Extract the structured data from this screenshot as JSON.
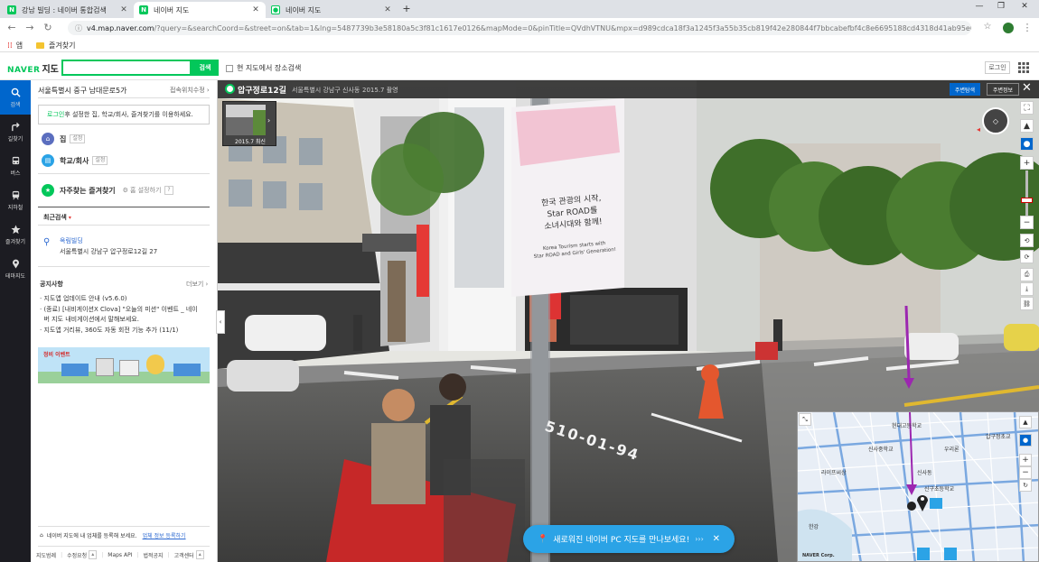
{
  "browser": {
    "tabs": [
      {
        "label": "강남 빌딩 : 네이버 통합검색",
        "favicon": "N"
      },
      {
        "label": "네이버 지도",
        "favicon": "N"
      },
      {
        "label": "네이버 지도",
        "favicon": "leaf"
      }
    ],
    "new_tab": "+",
    "url_host": "v4.map.naver.com",
    "url_path": "/?query=&searchCoord=&street=on&tab=1&lng=5487739b3e58180a5c3f81c1617e0126&mapMode=0&pinTitle=QVdhVTNU&mpx=d989cdca18f3a1245f3a55b35cb819f42e280844f7bbcabefbf4c8e6695188cd4318d41ab95e0e387a398ee5a208...",
    "bookmarks": {
      "apps": "앱",
      "favorites": "즐겨찾기"
    },
    "window_controls": [
      "—",
      "❐",
      "✕"
    ]
  },
  "header": {
    "logo_naver": "NAVER",
    "logo_map": "지도",
    "search_value": "",
    "search_button": "검색",
    "in_map_search": "현 지도에서 장소검색",
    "login": "로그인"
  },
  "rail": {
    "items": [
      {
        "label": "검색",
        "icon": "search-icon"
      },
      {
        "label": "길찾기",
        "icon": "directions-icon"
      },
      {
        "label": "버스",
        "icon": "bus-icon"
      },
      {
        "label": "지하철",
        "icon": "subway-icon"
      },
      {
        "label": "즐겨찾기",
        "icon": "star-icon"
      },
      {
        "label": "테마지도",
        "icon": "pin-icon"
      }
    ]
  },
  "panel": {
    "location": "서울특별시 중구 남대문로5가",
    "location_link": "접속위치수정",
    "login_prompt_link": "로그인",
    "login_prompt_rest": " 후 설정한 집, 학교/회사, 즐겨찾기를 이용하세요.",
    "home_label": "집",
    "home_badge": "설정",
    "work_label": "학교/회사",
    "work_badge": "설정",
    "fav_label": "자주찾는 즐겨찾기",
    "fav_settings": "홈 설정하기",
    "fav_help": "?",
    "recent_title": "최근검색",
    "recent_item_name": "옥림빌딩",
    "recent_item_addr": "서울특별시 강남구 압구정로12길 27",
    "notice_title": "공지사항",
    "notice_more": "더보기",
    "notices": [
      "· 지도앱 업데이트 안내 (v5.6.0)",
      "· (종료) [내비게이션X Clova] \"오늘의 미션\" 이벤트 _ 네이",
      "  버 지도 내비게이션에서 말해보세요.",
      "· 지도앱 거리뷰, 360도 자동 회전 기능 추가 (11/1)"
    ],
    "banner_text": "정비 이벤트",
    "biz_text": "네이버 지도에 내 업체를 등록해 보세요.",
    "biz_link": "업체 정보 등록하기",
    "footer_links": [
      "지도범례",
      "수정요청",
      "Maps API",
      "법적공지",
      "고객센터"
    ]
  },
  "viewer": {
    "street_name": "압구정로12길",
    "address": "서울특별시 강남구 신사동",
    "date": "2015.7 촬영",
    "nearby_button": "주변탐색",
    "info_button": "주변정보",
    "thumb_date": "2015.7 최신",
    "banner_line1": "한국 관광의 시작,",
    "banner_line2": "Star ROAD를",
    "banner_line3": "소녀시대와 함께!",
    "banner_en1": "Korea Tourism starts with",
    "banner_en2": "Star ROAD and Girls' Generation!",
    "road_marking": "510-01-94",
    "promo_text": "새로워진 네이버 PC 지도를 만나보세요!",
    "minimap_labels": [
      "현대고등학교",
      "신사중학교",
      "우리론",
      "압구정초교",
      "라이프씨상",
      "신사동",
      "신구초등학교",
      "한강",
      "NAVER Corp."
    ]
  },
  "colors": {
    "naver_green": "#03c75a",
    "rail_bg": "#1c1c22",
    "active_blue": "#0066cc",
    "promo_blue": "#2ba3e6"
  }
}
